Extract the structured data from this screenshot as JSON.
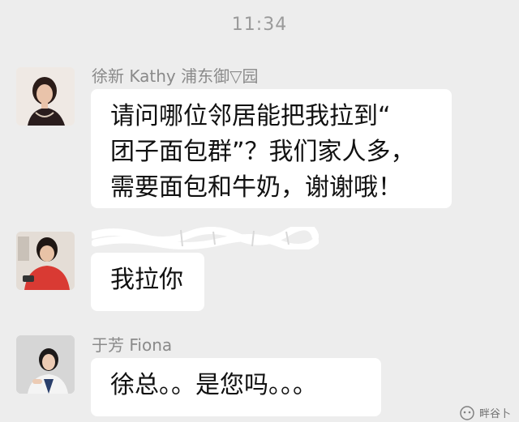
{
  "header": {
    "time": "11:34"
  },
  "messages": [
    {
      "sender": "徐新 Kathy 浦东御▽园",
      "text": "请问哪位邻居能把我拉到“\n团子面包群”？我们家人多，\n需要面包和牛奶，谢谢哦！",
      "avatar_icon": "woman-portrait-avatar"
    },
    {
      "sender": "",
      "text": "我拉你",
      "avatar_icon": "woman-red-top-avatar"
    },
    {
      "sender": "于芳 Fiona",
      "text": "徐总。。是您吗。。。",
      "avatar_icon": "woman-white-shirt-avatar"
    }
  ],
  "colors": {
    "background": "#ededed",
    "bubble": "#ffffff",
    "meta_text": "#8a8a8a"
  },
  "watermark": {
    "icon": "wechat-official-account-icon",
    "text": "畔谷卜"
  }
}
